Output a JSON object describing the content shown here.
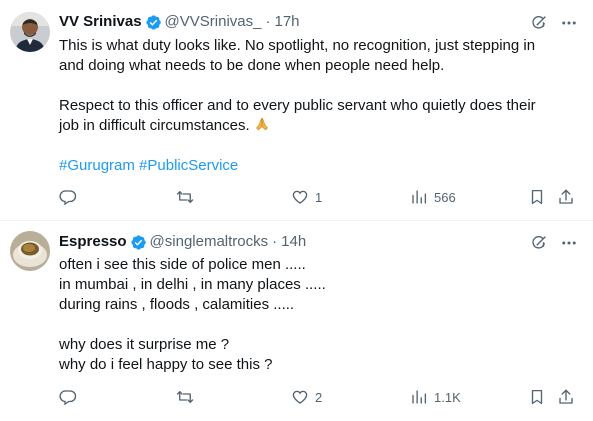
{
  "tweets": [
    {
      "name": "VV Srinivas",
      "handle": "@VVSrinivas_",
      "separator": "·",
      "time": "17h",
      "text_lines": [
        "This is what duty looks like. No spotlight, no recognition, just stepping in",
        "and doing what needs to be done when people need help.",
        "",
        "Respect to this officer and to every public servant who quietly does their",
        "job in difficult circumstances."
      ],
      "emoji": "folded-hands",
      "hashtags": "#Gurugram #PublicService",
      "stats": {
        "replies": "",
        "retweets": "",
        "likes": "1",
        "views": "566"
      }
    },
    {
      "name": "Espresso",
      "handle": "@singlemaltrocks",
      "separator": "·",
      "time": "14h",
      "text_lines": [
        "often i see this side of police men .....",
        "in mumbai , in delhi , in many places .....",
        "during rains , floods , calamities .....",
        "",
        "why does it surprise me ?",
        "why do i feel happy to see this ?"
      ],
      "stats": {
        "replies": "",
        "retweets": "",
        "likes": "2",
        "views": "1.1K"
      }
    }
  ],
  "colors": {
    "text": "#0f1419",
    "secondary": "#536471",
    "link": "#1d9bf0",
    "verified": "#1d9bf0",
    "divider": "#eff3f4"
  },
  "icons": [
    "verified-badge-icon",
    "grok-icon",
    "more-icon",
    "reply-icon",
    "retweet-icon",
    "like-icon",
    "views-icon",
    "bookmark-icon",
    "share-icon"
  ]
}
